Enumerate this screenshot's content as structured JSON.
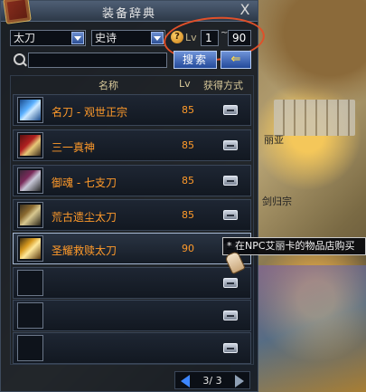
{
  "window": {
    "title": "装备辞典",
    "close_label": "X"
  },
  "filters": {
    "category": "太刀",
    "rarity": "史诗",
    "lv_label": "Lv",
    "lv_min": "1",
    "lv_sep": "~",
    "lv_max": "90"
  },
  "search": {
    "placeholder": "",
    "button_label": "搜索",
    "back_label": "⇐"
  },
  "table": {
    "columns": [
      "名称",
      "Lv",
      "获得方式"
    ],
    "rows": [
      {
        "name": "名刀 - 观世正宗",
        "lv": "85",
        "selected": false
      },
      {
        "name": "三一真神",
        "lv": "85",
        "selected": false
      },
      {
        "name": "御魂 - 七支刀",
        "lv": "85",
        "selected": false
      },
      {
        "name": "荒古遗尘太刀",
        "lv": "85",
        "selected": false
      },
      {
        "name": "圣耀救赎太刀",
        "lv": "90",
        "selected": true
      }
    ],
    "empty_rows": 3
  },
  "tooltip": "* 在NPC艾丽卡的物品店购买",
  "pager": {
    "current": "3",
    "total": "3",
    "text": "3/ 3"
  },
  "background_text": {
    "npc1": "丽亚",
    "npc2": "剑归宗"
  },
  "colors": {
    "item_name": "#ff9a2a",
    "accent_blue": "#3d86ff",
    "highlight_circle": "#e0502a"
  }
}
